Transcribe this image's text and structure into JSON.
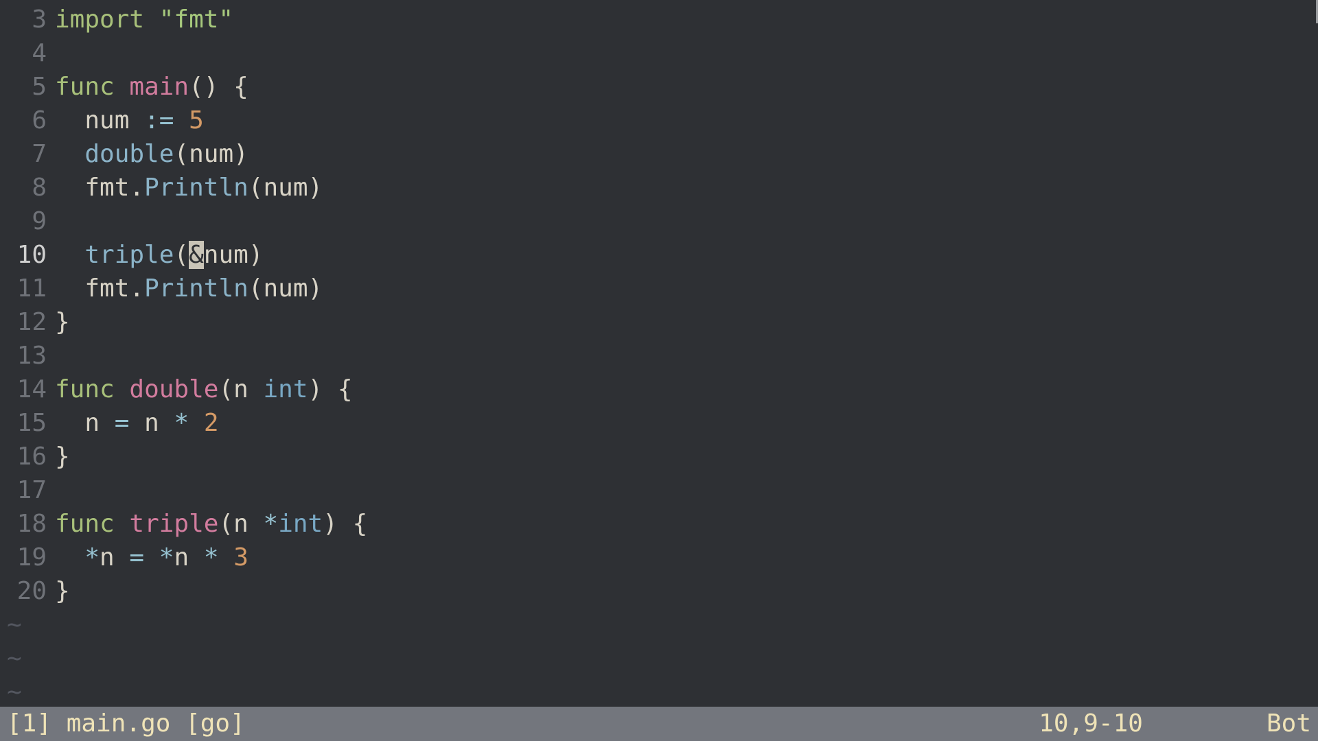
{
  "cursor": {
    "line": 10,
    "col": 9
  },
  "lines": [
    {
      "n": 3,
      "tokens": [
        [
          "kw",
          "import"
        ],
        [
          "punct",
          " "
        ],
        [
          "str",
          "\"fmt\""
        ]
      ]
    },
    {
      "n": 4,
      "tokens": []
    },
    {
      "n": 5,
      "tokens": [
        [
          "kw",
          "func"
        ],
        [
          "punct",
          " "
        ],
        [
          "fn",
          "main"
        ],
        [
          "punct",
          "() {"
        ]
      ]
    },
    {
      "n": 6,
      "tokens": [
        [
          "punct",
          "  "
        ],
        [
          "ident",
          "num"
        ],
        [
          "punct",
          " "
        ],
        [
          "op",
          ":="
        ],
        [
          "punct",
          " "
        ],
        [
          "num",
          "5"
        ]
      ]
    },
    {
      "n": 7,
      "tokens": [
        [
          "punct",
          "  "
        ],
        [
          "call",
          "double"
        ],
        [
          "punct",
          "("
        ],
        [
          "ident",
          "num"
        ],
        [
          "punct",
          ")"
        ]
      ]
    },
    {
      "n": 8,
      "tokens": [
        [
          "punct",
          "  "
        ],
        [
          "ident",
          "fmt"
        ],
        [
          "punct",
          "."
        ],
        [
          "call",
          "Println"
        ],
        [
          "punct",
          "("
        ],
        [
          "ident",
          "num"
        ],
        [
          "punct",
          ")"
        ]
      ]
    },
    {
      "n": 9,
      "tokens": []
    },
    {
      "n": 10,
      "current": true,
      "tokens": [
        [
          "punct",
          "  "
        ],
        [
          "call",
          "triple"
        ],
        [
          "punct",
          "("
        ],
        [
          "op cursor",
          "&"
        ],
        [
          "ident",
          "num"
        ],
        [
          "punct",
          ")"
        ]
      ]
    },
    {
      "n": 11,
      "tokens": [
        [
          "punct",
          "  "
        ],
        [
          "ident",
          "fmt"
        ],
        [
          "punct",
          "."
        ],
        [
          "call",
          "Println"
        ],
        [
          "punct",
          "("
        ],
        [
          "ident",
          "num"
        ],
        [
          "punct",
          ")"
        ]
      ]
    },
    {
      "n": 12,
      "tokens": [
        [
          "punct",
          "}"
        ]
      ]
    },
    {
      "n": 13,
      "tokens": []
    },
    {
      "n": 14,
      "tokens": [
        [
          "kw",
          "func"
        ],
        [
          "punct",
          " "
        ],
        [
          "fn",
          "double"
        ],
        [
          "punct",
          "("
        ],
        [
          "ident",
          "n"
        ],
        [
          "punct",
          " "
        ],
        [
          "type",
          "int"
        ],
        [
          "punct",
          ") {"
        ]
      ]
    },
    {
      "n": 15,
      "tokens": [
        [
          "punct",
          "  "
        ],
        [
          "ident",
          "n"
        ],
        [
          "punct",
          " "
        ],
        [
          "op",
          "="
        ],
        [
          "punct",
          " "
        ],
        [
          "ident",
          "n"
        ],
        [
          "punct",
          " "
        ],
        [
          "op",
          "*"
        ],
        [
          "punct",
          " "
        ],
        [
          "num",
          "2"
        ]
      ]
    },
    {
      "n": 16,
      "tokens": [
        [
          "punct",
          "}"
        ]
      ]
    },
    {
      "n": 17,
      "tokens": []
    },
    {
      "n": 18,
      "tokens": [
        [
          "kw",
          "func"
        ],
        [
          "punct",
          " "
        ],
        [
          "fn",
          "triple"
        ],
        [
          "punct",
          "("
        ],
        [
          "ident",
          "n"
        ],
        [
          "punct",
          " "
        ],
        [
          "op",
          "*"
        ],
        [
          "type",
          "int"
        ],
        [
          "punct",
          ") {"
        ]
      ]
    },
    {
      "n": 19,
      "tokens": [
        [
          "punct",
          "  "
        ],
        [
          "op",
          "*"
        ],
        [
          "ident",
          "n"
        ],
        [
          "punct",
          " "
        ],
        [
          "op",
          "="
        ],
        [
          "punct",
          " "
        ],
        [
          "op",
          "*"
        ],
        [
          "ident",
          "n"
        ],
        [
          "punct",
          " "
        ],
        [
          "op",
          "*"
        ],
        [
          "punct",
          " "
        ],
        [
          "num",
          "3"
        ]
      ]
    },
    {
      "n": 20,
      "tokens": [
        [
          "punct",
          "}"
        ]
      ]
    }
  ],
  "tilde_count": 3,
  "status": {
    "left": "[1] main.go [go]",
    "position": "10,9-10",
    "right": "Bot"
  }
}
